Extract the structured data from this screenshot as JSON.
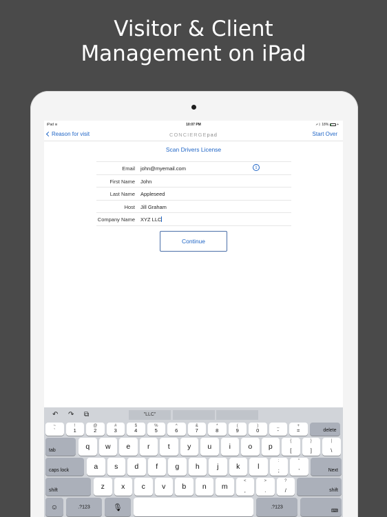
{
  "promo": {
    "line1": "Visitor & Client",
    "line2": "Management on iPad"
  },
  "status_bar": {
    "device": "iPad",
    "time": "10:07 PM",
    "battery": "18%"
  },
  "nav": {
    "back_label": "Reason for visit",
    "brand_main": "CONCIERGE",
    "brand_suffix": "pad",
    "start_over": "Start Over"
  },
  "scan_link": "Scan Drivers License",
  "form": {
    "fields": [
      {
        "label": "Email",
        "value": "john@myemail.com"
      },
      {
        "label": "First Name",
        "value": "John"
      },
      {
        "label": "Last Name",
        "value": "Appleseed"
      },
      {
        "label": "Host",
        "value": "Jill Graham"
      },
      {
        "label": "Company Name",
        "value": "XYZ LLC"
      }
    ],
    "info_glyph": "i"
  },
  "continue_label": "Continue",
  "keyboard": {
    "toolbar": {
      "undo": "↶",
      "redo": "↷",
      "paste": "⧉",
      "suggestions": [
        "\"LLC\"",
        "",
        ""
      ]
    },
    "row1": [
      {
        "alt": "~",
        "main": "`"
      },
      {
        "alt": "!",
        "main": "1"
      },
      {
        "alt": "@",
        "main": "2"
      },
      {
        "alt": "#",
        "main": "3"
      },
      {
        "alt": "$",
        "main": "4"
      },
      {
        "alt": "%",
        "main": "5"
      },
      {
        "alt": "^",
        "main": "6"
      },
      {
        "alt": "&",
        "main": "7"
      },
      {
        "alt": "*",
        "main": "8"
      },
      {
        "alt": "(",
        "main": "9"
      },
      {
        "alt": ")",
        "main": "0"
      },
      {
        "alt": "_",
        "main": "-"
      },
      {
        "alt": "+",
        "main": "="
      }
    ],
    "delete": "delete",
    "tab": "tab",
    "row2": [
      "q",
      "w",
      "e",
      "r",
      "t",
      "y",
      "u",
      "i",
      "o",
      "p"
    ],
    "row2_punct": [
      {
        "alt": "{",
        "main": "["
      },
      {
        "alt": "}",
        "main": "]"
      },
      {
        "alt": "|",
        "main": "\\"
      }
    ],
    "caps_lock": "caps lock",
    "row3": [
      "a",
      "s",
      "d",
      "f",
      "g",
      "h",
      "j",
      "k",
      "l"
    ],
    "row3_punct": [
      {
        "alt": ":",
        "main": ";"
      },
      {
        "alt": "\"",
        "main": "'"
      }
    ],
    "next": "Next",
    "shift": "shift",
    "row4": [
      "z",
      "x",
      "c",
      "v",
      "b",
      "n",
      "m"
    ],
    "row4_punct": [
      {
        "alt": "<",
        "main": ","
      },
      {
        "alt": ">",
        "main": "."
      },
      {
        "alt": "?",
        "main": "/"
      }
    ],
    "emoji": "☺",
    "numbers": ".?123",
    "mic": "🎙",
    "hide": "⌨"
  }
}
